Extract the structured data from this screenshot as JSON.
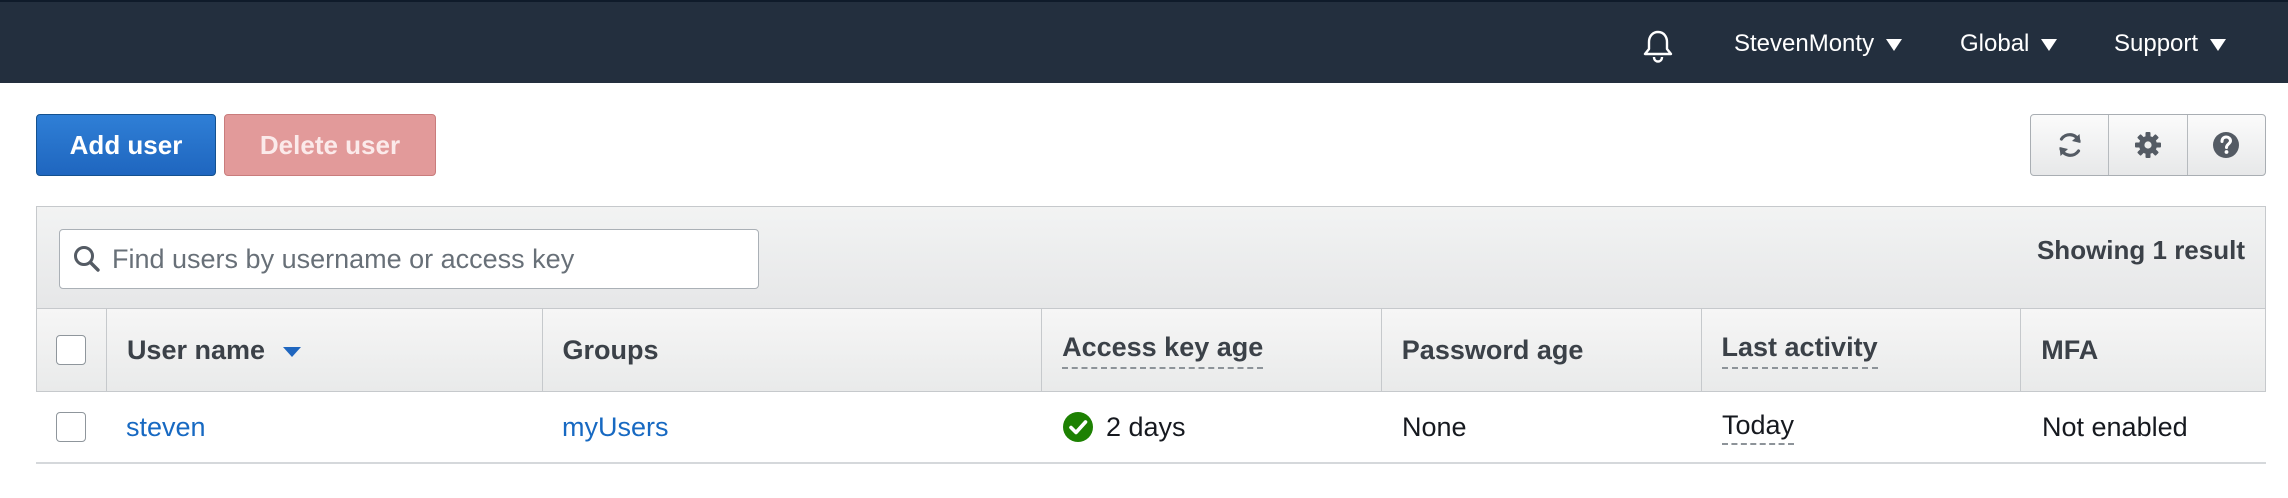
{
  "topnav": {
    "bell_icon": "bell-icon",
    "account_label": "StevenMonty",
    "region_label": "Global",
    "support_label": "Support"
  },
  "toolbar": {
    "add_user_label": "Add user",
    "delete_user_label": "Delete user",
    "icons": [
      "refresh-icon",
      "gear-icon",
      "help-icon"
    ]
  },
  "filter": {
    "search_placeholder": "Find users by username or access key",
    "search_value": "",
    "result_text": "Showing 1 result"
  },
  "table": {
    "columns": [
      "User name",
      "Groups",
      "Access key age",
      "Password age",
      "Last activity",
      "MFA"
    ],
    "rows": [
      {
        "user_name": "steven",
        "groups": "myUsers",
        "access_key_age": "2 days",
        "password_age": "None",
        "last_activity": "Today",
        "mfa": "Not enabled"
      }
    ]
  },
  "colors": {
    "nav_bg": "#232f3e",
    "primary": "#1f66bf",
    "danger_disabled": "#e29a9a",
    "link": "#1769c2",
    "success": "#1d8102"
  }
}
